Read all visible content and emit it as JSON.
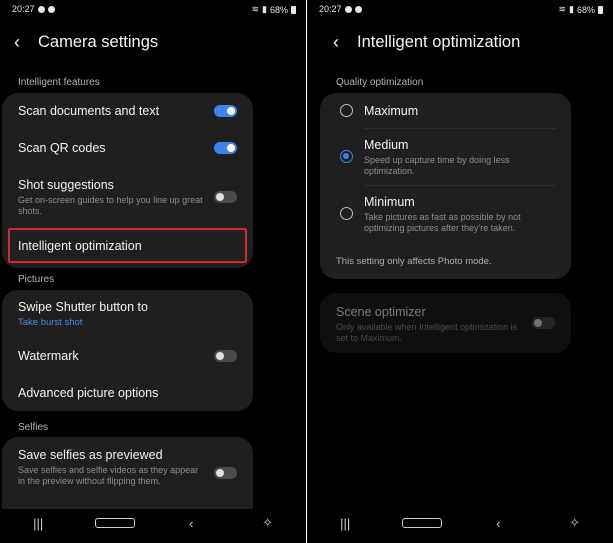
{
  "left": {
    "status": {
      "time": "20:27",
      "battery": "68%"
    },
    "title": "Camera settings",
    "sections": {
      "intelligent": "Intelligent features",
      "pictures": "Pictures",
      "selfies": "Selfies"
    },
    "items": {
      "scan_docs": {
        "title": "Scan documents and text",
        "on": true
      },
      "scan_qr": {
        "title": "Scan QR codes",
        "on": true
      },
      "shot_suggestions": {
        "title": "Shot suggestions",
        "subtitle": "Get on-screen guides to help you line up great shots.",
        "on": false
      },
      "intelligent_opt": {
        "title": "Intelligent optimization"
      },
      "swipe_shutter": {
        "title": "Swipe Shutter button to",
        "value": "Take burst shot"
      },
      "watermark": {
        "title": "Watermark",
        "on": false
      },
      "advanced": {
        "title": "Advanced picture options"
      },
      "save_selfies": {
        "title": "Save selfies as previewed",
        "subtitle": "Save selfies and selfie videos as they appear in the preview without flipping them.",
        "on": false
      }
    }
  },
  "right": {
    "status": {
      "time": "20:27",
      "battery": "68%"
    },
    "title": "Intelligent optimization",
    "section": "Quality optimization",
    "options": [
      {
        "title": "Maximum",
        "subtitle": "",
        "selected": false
      },
      {
        "title": "Medium",
        "subtitle": "Speed up capture time by doing less optimization.",
        "selected": true
      },
      {
        "title": "Minimum",
        "subtitle": "Take pictures as fast as possible by not optimizing pictures after they're taken.",
        "selected": false
      }
    ],
    "note": "This setting only affects Photo mode.",
    "scene_optimizer": {
      "title": "Scene optimizer",
      "subtitle": "Only available when Intelligent optimization is set to Maximum.",
      "on": false
    }
  },
  "colors": {
    "accent": "#3e82f0",
    "highlight": "#d2282e",
    "card": "#1f1f1f",
    "background": "#000000"
  }
}
